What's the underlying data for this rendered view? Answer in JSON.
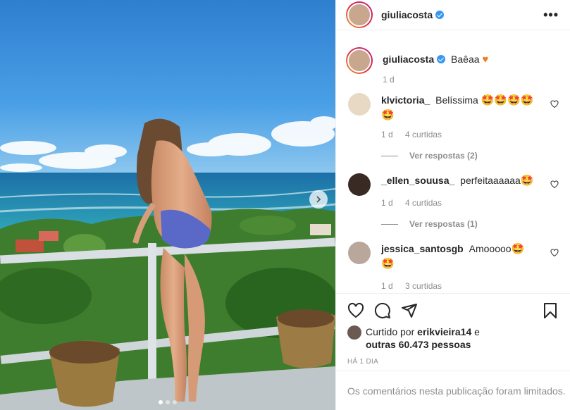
{
  "post": {
    "author": "giuliacosta",
    "more_label": "•••",
    "caption_text": "Baêaa",
    "caption_emoji": "♥",
    "caption_age": "1 d"
  },
  "comments": [
    {
      "user": "klvictoria_",
      "text": "Belíssima",
      "emoji_line1": "🤩🤩🤩🤩",
      "emoji_line2": "🤩",
      "age": "1 d",
      "likes": "4 curtidas",
      "replies": "Ver respostas (2)",
      "avatar_color": "#e7d9c4"
    },
    {
      "user": "_ellen_souusa_",
      "text": "perfeitaaaaaa",
      "emoji_line1": "🤩",
      "age": "1 d",
      "likes": "4 curtidas",
      "replies": "Ver respostas (1)",
      "avatar_color": "#3a2a24"
    },
    {
      "user": "jessica_santosgb",
      "text": "Amooooo",
      "emoji_line1": "🤩🤩",
      "age": "1 d",
      "likes": "3 curtidas",
      "avatar_color": "#b9a79c"
    }
  ],
  "likes": {
    "prefix": "Curtido por",
    "user": "erikvieira14",
    "conj": "e",
    "others": "outras 60.473 pessoas"
  },
  "timestamp": "Há 1 dia",
  "comments_limited": "Os comentários nesta publicação foram limitados.",
  "carousel": {
    "total": 3,
    "current": 1
  },
  "icons": {
    "like": "heart-icon",
    "comment": "comment-icon",
    "share": "share-icon",
    "save": "bookmark-icon",
    "next": "chevron-right-icon",
    "verified": "verified-badge-icon"
  },
  "colors": {
    "verified": "#3897f0",
    "muted": "#8e8e8e",
    "border": "#efefef"
  }
}
